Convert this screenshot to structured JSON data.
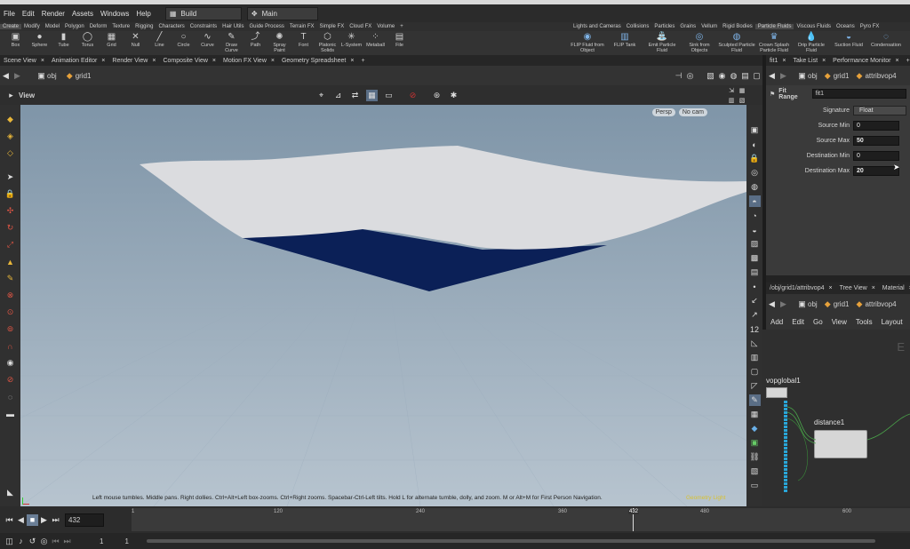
{
  "menubar": {
    "items": [
      "File",
      "Edit",
      "Render",
      "Assets",
      "Windows",
      "Help"
    ],
    "desktop": "Build",
    "context": "Main"
  },
  "shelf": {
    "tabs_left": [
      "Create",
      "Modify",
      "Model",
      "Polygon",
      "Deform",
      "Texture",
      "Rigging",
      "Characters",
      "Constraints",
      "Hair Utils",
      "Guide Process",
      "Terrain FX",
      "Simple FX",
      "Cloud FX",
      "Volume",
      "+"
    ],
    "tabs_right": [
      "Lights and Cameras",
      "Collisions",
      "Particles",
      "Grains",
      "Vellum",
      "Rigid Bodies",
      "Particle Fluids",
      "Viscous Fluids",
      "Oceans",
      "Pyro FX"
    ],
    "active_right_tab": "Particle Fluids",
    "tools_left": [
      {
        "label": "Box",
        "icon": "box-icon"
      },
      {
        "label": "Sphere",
        "icon": "sphere-icon"
      },
      {
        "label": "Tube",
        "icon": "tube-icon"
      },
      {
        "label": "Torus",
        "icon": "torus-icon"
      },
      {
        "label": "Grid",
        "icon": "grid-icon"
      },
      {
        "label": "Null",
        "icon": "null-icon"
      },
      {
        "label": "Line",
        "icon": "line-icon"
      },
      {
        "label": "Circle",
        "icon": "circle-icon"
      },
      {
        "label": "Curve",
        "icon": "curve-icon"
      },
      {
        "label": "Draw Curve",
        "icon": "draw-curve-icon"
      },
      {
        "label": "Path",
        "icon": "path-icon"
      },
      {
        "label": "Spray Paint",
        "icon": "spray-paint-icon"
      },
      {
        "label": "Font",
        "icon": "font-icon"
      },
      {
        "label": "Platonic Solids",
        "icon": "platonic-icon"
      },
      {
        "label": "L-System",
        "icon": "lsystem-icon"
      },
      {
        "label": "Metaball",
        "icon": "metaball-icon"
      },
      {
        "label": "File",
        "icon": "file-icon"
      }
    ],
    "tools_right": [
      {
        "label": "FLIP Fluid from Object",
        "icon": "flip-fluid-icon"
      },
      {
        "label": "FLIP Tank",
        "icon": "flip-tank-icon"
      },
      {
        "label": "Emit Particle Fluid",
        "icon": "emit-fluid-icon"
      },
      {
        "label": "Sink from Objects",
        "icon": "sink-icon"
      },
      {
        "label": "Sculpted Particle Fluid",
        "icon": "sculpted-fluid-icon"
      },
      {
        "label": "Crown Splash Particle Fluid",
        "icon": "crown-splash-icon"
      },
      {
        "label": "Drip Particle Fluid",
        "icon": "drip-fluid-icon"
      },
      {
        "label": "Suction Fluid",
        "icon": "suction-fluid-icon"
      },
      {
        "label": "Condensation",
        "icon": "condensation-icon"
      }
    ]
  },
  "panes_left": {
    "tabs": [
      "Scene View",
      "Animation Editor",
      "Render View",
      "Composite View",
      "Motion FX View",
      "Geometry Spreadsheet"
    ],
    "path": [
      "obj",
      "grid1"
    ],
    "view_label": "View",
    "persp": "Persp",
    "cam": "No cam"
  },
  "viewport": {
    "status_message": "Left mouse tumbles. Middle pans. Right dollies. Ctrl+Alt+Left box-zooms. Ctrl+Right zooms. Spacebar-Ctrl-Left tilts. Hold L for alternate tumble, dolly, and zoom.    M or Alt+M for First Person Navigation.",
    "status_extra": "Geometry Light",
    "colors": {
      "cloth_top": "#d9dadd",
      "cloth_under": "#0b2057"
    }
  },
  "params_pane": {
    "tabs": [
      "fit1",
      "Take List",
      "Performance Monitor"
    ],
    "path": [
      "obj",
      "grid1",
      "attribvop4"
    ],
    "node_type": "Fit Range",
    "node_name": "fit1",
    "params": [
      {
        "label": "Signature",
        "value": "Float"
      },
      {
        "label": "Source Min",
        "value": "0"
      },
      {
        "label": "Source Max",
        "value": "50"
      },
      {
        "label": "Destination Min",
        "value": "0"
      },
      {
        "label": "Destination Max",
        "value": "20"
      }
    ]
  },
  "network_pane": {
    "tabs": [
      "/obj/grid1/attribvop4",
      "Tree View",
      "Material"
    ],
    "path": [
      "obj",
      "grid1",
      "attribvop4"
    ],
    "menu": [
      "Add",
      "Edit",
      "Go",
      "View",
      "Tools",
      "Layout"
    ],
    "nodes": [
      {
        "name": "vopglobal1"
      },
      {
        "name": "distance1"
      }
    ]
  },
  "timeline": {
    "current_frame": "432",
    "ticks": [
      "1",
      "120",
      "240",
      "360",
      "432",
      "480",
      "600"
    ],
    "range_start": "1",
    "range_start2": "1"
  }
}
